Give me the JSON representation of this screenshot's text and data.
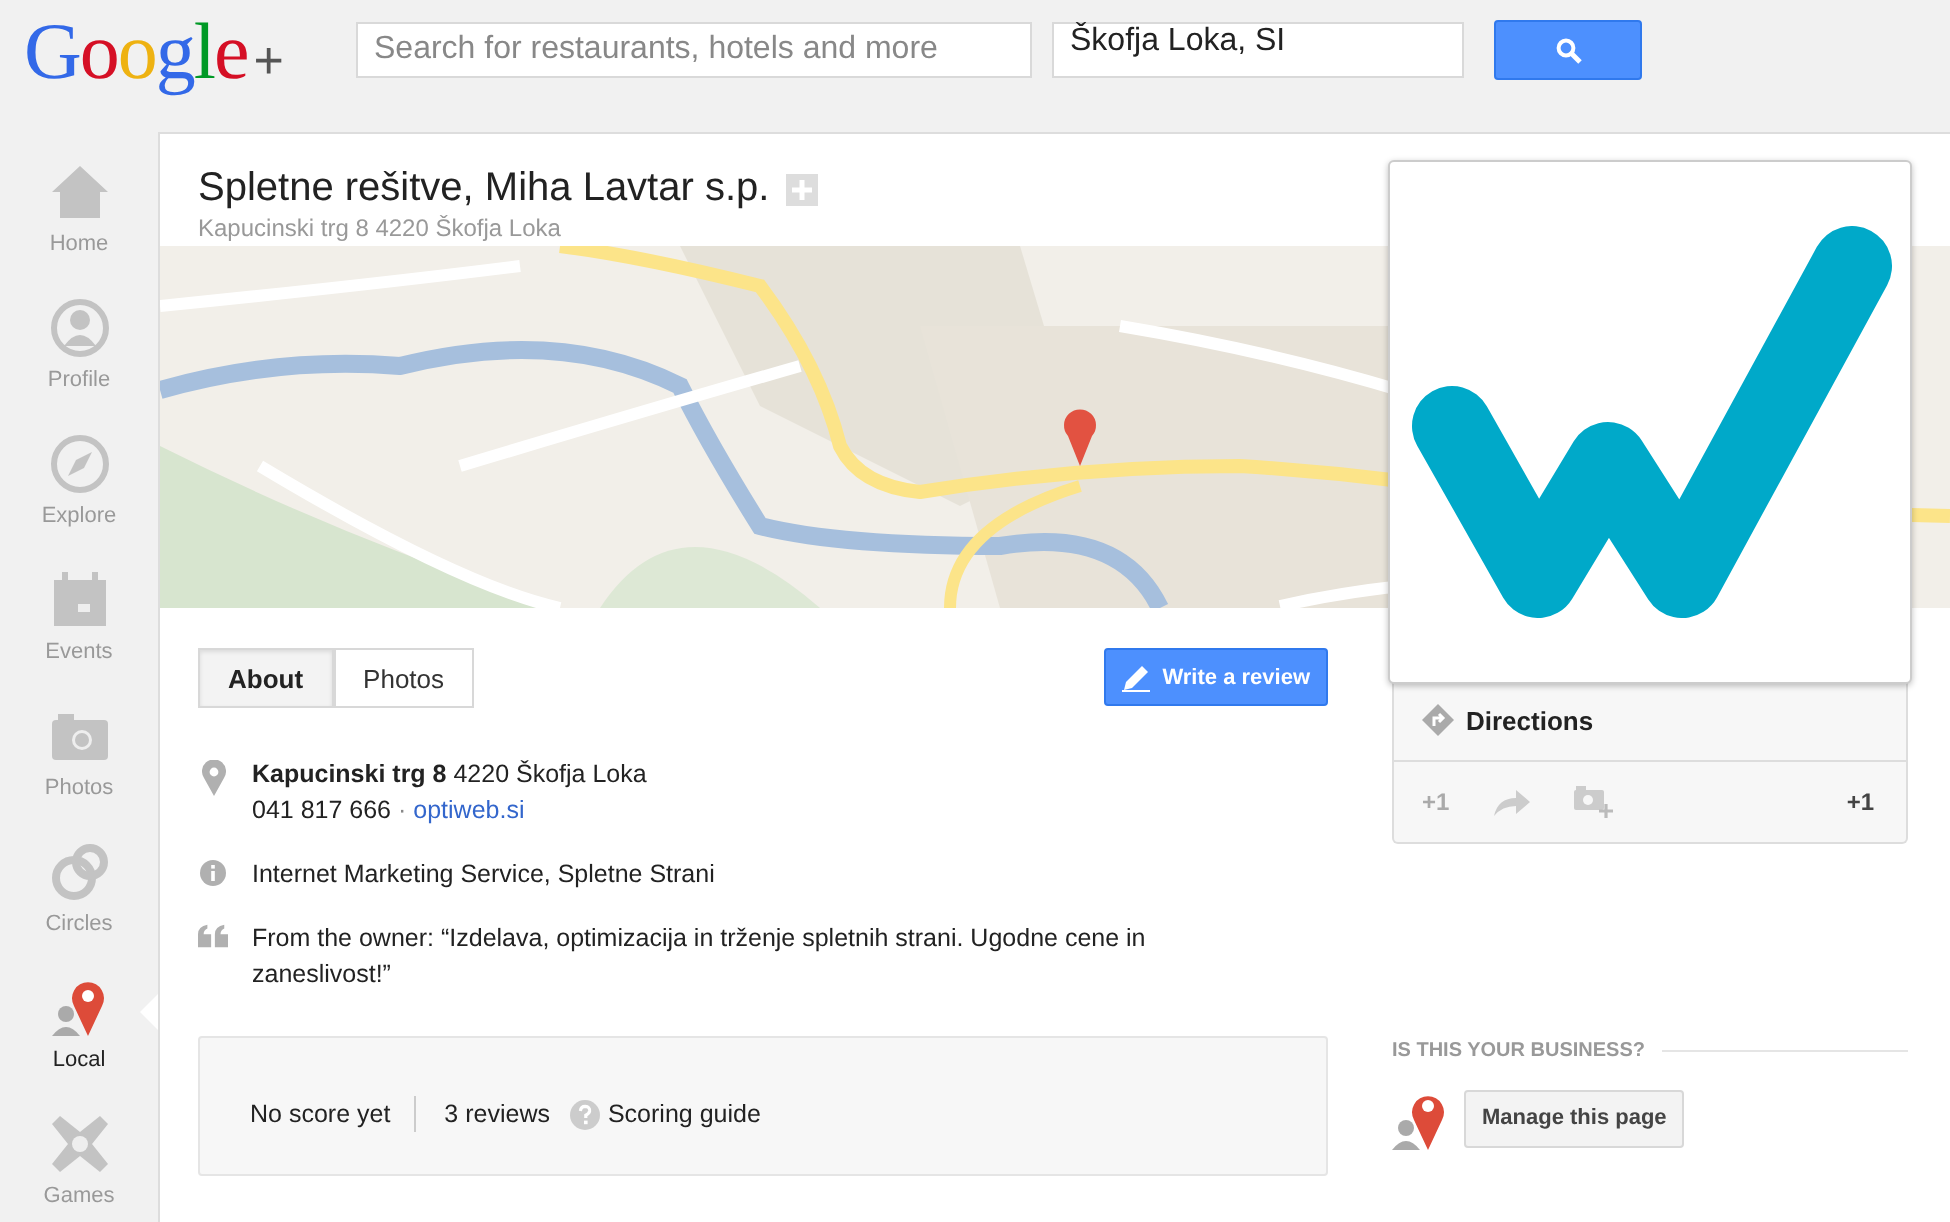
{
  "header": {
    "logo": "Google",
    "logo_plus": "+",
    "search": {
      "placeholder": "Search for restaurants, hotels and more"
    },
    "location": {
      "value": "Škofja Loka, SI"
    }
  },
  "nav": [
    {
      "label": "Home",
      "kind": "home",
      "selected": false
    },
    {
      "label": "Profile",
      "kind": "profile",
      "selected": false
    },
    {
      "label": "Explore",
      "kind": "explore",
      "selected": false
    },
    {
      "label": "Events",
      "kind": "events",
      "selected": false
    },
    {
      "label": "Photos",
      "kind": "photos",
      "selected": false
    },
    {
      "label": "Circles",
      "kind": "circles",
      "selected": false
    },
    {
      "label": "Local",
      "kind": "local",
      "selected": true
    },
    {
      "label": "Games",
      "kind": "games",
      "selected": false
    }
  ],
  "place": {
    "title": "Spletne rešitve, Miha Lavtar s.p.",
    "address": "Kapucinski trg 8 4220 Škofja Loka"
  },
  "tabs": [
    {
      "label": "About",
      "selected": true
    },
    {
      "label": "Photos",
      "selected": false
    }
  ],
  "write_review": "Write a review",
  "details": [
    {
      "kind": "address",
      "street": "Kapucinski trg 8",
      "city": "4220 Škofja Loka",
      "phone": "041 817 666",
      "separator": "·",
      "website": "optiweb.si"
    },
    {
      "kind": "category",
      "text": "Internet Marketing Service, Spletne Strani"
    },
    {
      "kind": "quote",
      "text": "From the owner: “Izdelava, optimizacija in trženje spletnih strani. Ugodne cene in zaneslivost!”"
    }
  ],
  "score": {
    "score": "No score yet",
    "reviews": "3 reviews",
    "guide": "Scoring guide"
  },
  "actions": {
    "directions": "Directions",
    "plus_one": "+1",
    "plus_one_button": "+1"
  },
  "business": {
    "heading": "IS THIS YOUR BUSINESS?",
    "manage": "Manage this page"
  }
}
